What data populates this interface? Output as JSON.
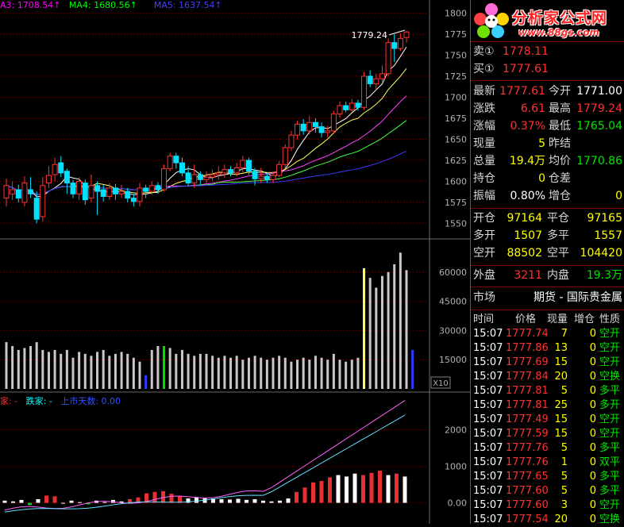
{
  "price_chart": {
    "ma_legend": [
      {
        "label": "A3: 1708.54↑",
        "color": "#ff00ff"
      },
      {
        "label": "MA4: 1680.56↑",
        "color": "#00ff00"
      },
      {
        "label": "MA5: 1637.54↑",
        "color": "#4040ff"
      }
    ],
    "high_label": "1779.24",
    "y_ticks": [
      "1800",
      "1775",
      "1750",
      "1725",
      "1700",
      "1675",
      "1650",
      "1625",
      "1600",
      "1575",
      "1550"
    ]
  },
  "volume_chart": {
    "y_ticks": [
      "60000",
      "45000",
      "30000",
      "15000"
    ],
    "multiplier": "X10"
  },
  "indicator_chart": {
    "legend": [
      {
        "label": "家: -",
        "color": "#ff3030"
      },
      {
        "label": "跌家: -",
        "color": "#00ffff"
      },
      {
        "label": "上市天数: 0.00",
        "color": "#3050ff"
      }
    ],
    "y_ticks": [
      "2000",
      "1000",
      "0.00"
    ]
  },
  "quote": {
    "logo_title": "分析家公式网",
    "logo_url": "www.88gs.com",
    "sell": {
      "label": "卖①",
      "price": "1778.11"
    },
    "buy": {
      "label": "买①",
      "price": "1777.61"
    },
    "rows": [
      {
        "l1": "最新",
        "v1": "1777.61",
        "c1": "red",
        "l2": "今开",
        "v2": "1771.00",
        "c2": "white"
      },
      {
        "l1": "涨跌",
        "v1": "6.61",
        "c1": "red",
        "l2": "最高",
        "v2": "1779.24",
        "c2": "red"
      },
      {
        "l1": "涨幅",
        "v1": "0.37%",
        "c1": "red",
        "l2": "最低",
        "v2": "1765.04",
        "c2": "green"
      },
      {
        "l1": "现量",
        "v1": "5",
        "c1": "yellow",
        "l2": "昨结",
        "v2": "",
        "c2": "white"
      },
      {
        "l1": "总量",
        "v1": "19.4万",
        "c1": "yellow",
        "l2": "均价",
        "v2": "1770.86",
        "c2": "green"
      },
      {
        "l1": "持仓",
        "v1": "0",
        "c1": "yellow",
        "l2": "仓差",
        "v2": "",
        "c2": "white"
      },
      {
        "l1": "振幅",
        "v1": "0.80%",
        "c1": "white",
        "l2": "增仓",
        "v2": "0",
        "c2": "yellow"
      }
    ],
    "rows2": [
      {
        "l1": "开仓",
        "v1": "97164",
        "c1": "yellow",
        "l2": "平仓",
        "v2": "97165",
        "c2": "yellow"
      },
      {
        "l1": "多开",
        "v1": "1507",
        "c1": "yellow",
        "l2": "多平",
        "v2": "1557",
        "c2": "yellow"
      },
      {
        "l1": "空开",
        "v1": "88502",
        "c1": "yellow",
        "l2": "空平",
        "v2": "104420",
        "c2": "yellow"
      }
    ],
    "outer": {
      "label": "外盘",
      "value": "3211"
    },
    "inner": {
      "label": "内盘",
      "value": "19.3万"
    },
    "market": {
      "label": "市场",
      "value": "期货 - 国际贵金属"
    },
    "trade_headers": [
      "时间",
      "价格",
      "现量",
      "增仓",
      "性质"
    ],
    "trades": [
      {
        "time": "15:07",
        "price": "1777.74",
        "vol": "7",
        "oi": "0",
        "type": "空开"
      },
      {
        "time": "15:07",
        "price": "1777.86",
        "vol": "13",
        "oi": "0",
        "type": "空开"
      },
      {
        "time": "15:07",
        "price": "1777.69",
        "vol": "15",
        "oi": "0",
        "type": "空开"
      },
      {
        "time": "15:07",
        "price": "1777.84",
        "vol": "20",
        "oi": "0",
        "type": "空换"
      },
      {
        "time": "15:07",
        "price": "1777.81",
        "vol": "5",
        "oi": "0",
        "type": "多平"
      },
      {
        "time": "15:07",
        "price": "1777.81",
        "vol": "25",
        "oi": "0",
        "type": "多开"
      },
      {
        "time": "15:07",
        "price": "1777.49",
        "vol": "15",
        "oi": "0",
        "type": "空开"
      },
      {
        "time": "15:07",
        "price": "1777.59",
        "vol": "15",
        "oi": "0",
        "type": "空开"
      },
      {
        "time": "15:07",
        "price": "1777.76",
        "vol": "5",
        "oi": "0",
        "type": "多平"
      },
      {
        "time": "15:07",
        "price": "1777.76",
        "vol": "1",
        "oi": "0",
        "type": "双平"
      },
      {
        "time": "15:07",
        "price": "1777.65",
        "vol": "5",
        "oi": "0",
        "type": "多平"
      },
      {
        "time": "15:07",
        "price": "1777.60",
        "vol": "5",
        "oi": "0",
        "type": "多平"
      },
      {
        "time": "15:07",
        "price": "1777.60",
        "vol": "3",
        "oi": "0",
        "type": "空开"
      },
      {
        "time": "15:07",
        "price": "1777.54",
        "vol": "20",
        "oi": "0",
        "type": "空换"
      }
    ]
  },
  "chart_data": [
    {
      "type": "candlestick",
      "ylim": [
        1540,
        1810
      ],
      "candles": [
        {
          "o": 1580,
          "c": 1595,
          "h": 1603,
          "l": 1570
        },
        {
          "o": 1585,
          "c": 1590,
          "h": 1600,
          "l": 1578
        },
        {
          "o": 1590,
          "c": 1580,
          "h": 1596,
          "l": 1575
        },
        {
          "o": 1575,
          "c": 1598,
          "h": 1606,
          "l": 1570
        },
        {
          "o": 1590,
          "c": 1585,
          "h": 1605,
          "l": 1580
        },
        {
          "o": 1580,
          "c": 1555,
          "h": 1588,
          "l": 1550
        },
        {
          "o": 1558,
          "c": 1595,
          "h": 1605,
          "l": 1552
        },
        {
          "o": 1598,
          "c": 1607,
          "h": 1618,
          "l": 1592
        },
        {
          "o": 1608,
          "c": 1620,
          "h": 1628,
          "l": 1600
        },
        {
          "o": 1622,
          "c": 1610,
          "h": 1630,
          "l": 1605
        },
        {
          "o": 1612,
          "c": 1598,
          "h": 1615,
          "l": 1585
        },
        {
          "o": 1598,
          "c": 1585,
          "h": 1602,
          "l": 1580
        },
        {
          "o": 1585,
          "c": 1600,
          "h": 1605,
          "l": 1578
        },
        {
          "o": 1598,
          "c": 1578,
          "h": 1602,
          "l": 1572
        },
        {
          "o": 1580,
          "c": 1595,
          "h": 1608,
          "l": 1575
        },
        {
          "o": 1595,
          "c": 1588,
          "h": 1600,
          "l": 1560
        },
        {
          "o": 1590,
          "c": 1582,
          "h": 1596,
          "l": 1576
        },
        {
          "o": 1582,
          "c": 1592,
          "h": 1598,
          "l": 1578
        },
        {
          "o": 1592,
          "c": 1585,
          "h": 1597,
          "l": 1578
        },
        {
          "o": 1585,
          "c": 1588,
          "h": 1596,
          "l": 1580
        },
        {
          "o": 1588,
          "c": 1580,
          "h": 1592,
          "l": 1575
        },
        {
          "o": 1580,
          "c": 1576,
          "h": 1585,
          "l": 1570
        },
        {
          "o": 1576,
          "c": 1592,
          "h": 1598,
          "l": 1570
        },
        {
          "o": 1592,
          "c": 1588,
          "h": 1596,
          "l": 1580
        },
        {
          "o": 1588,
          "c": 1595,
          "h": 1600,
          "l": 1584
        },
        {
          "o": 1595,
          "c": 1590,
          "h": 1599,
          "l": 1585
        },
        {
          "o": 1590,
          "c": 1615,
          "h": 1620,
          "l": 1588
        },
        {
          "o": 1615,
          "c": 1630,
          "h": 1634,
          "l": 1612
        },
        {
          "o": 1630,
          "c": 1622,
          "h": 1634,
          "l": 1615
        },
        {
          "o": 1622,
          "c": 1610,
          "h": 1628,
          "l": 1606
        },
        {
          "o": 1610,
          "c": 1598,
          "h": 1618,
          "l": 1594
        },
        {
          "o": 1598,
          "c": 1608,
          "h": 1620,
          "l": 1592
        },
        {
          "o": 1608,
          "c": 1602,
          "h": 1612,
          "l": 1596
        },
        {
          "o": 1602,
          "c": 1605,
          "h": 1612,
          "l": 1598
        },
        {
          "o": 1605,
          "c": 1608,
          "h": 1614,
          "l": 1600
        },
        {
          "o": 1608,
          "c": 1610,
          "h": 1618,
          "l": 1602
        },
        {
          "o": 1610,
          "c": 1614,
          "h": 1620,
          "l": 1604
        },
        {
          "o": 1614,
          "c": 1610,
          "h": 1618,
          "l": 1606
        },
        {
          "o": 1610,
          "c": 1616,
          "h": 1622,
          "l": 1606
        },
        {
          "o": 1616,
          "c": 1625,
          "h": 1630,
          "l": 1610
        },
        {
          "o": 1625,
          "c": 1612,
          "h": 1628,
          "l": 1608
        },
        {
          "o": 1612,
          "c": 1603,
          "h": 1616,
          "l": 1595
        },
        {
          "o": 1603,
          "c": 1606,
          "h": 1616,
          "l": 1598
        },
        {
          "o": 1606,
          "c": 1602,
          "h": 1610,
          "l": 1598
        },
        {
          "o": 1602,
          "c": 1607,
          "h": 1612,
          "l": 1598
        },
        {
          "o": 1607,
          "c": 1620,
          "h": 1624,
          "l": 1605
        },
        {
          "o": 1620,
          "c": 1640,
          "h": 1644,
          "l": 1615
        },
        {
          "o": 1640,
          "c": 1655,
          "h": 1660,
          "l": 1636
        },
        {
          "o": 1655,
          "c": 1668,
          "h": 1672,
          "l": 1650
        },
        {
          "o": 1668,
          "c": 1660,
          "h": 1674,
          "l": 1655
        },
        {
          "o": 1660,
          "c": 1670,
          "h": 1678,
          "l": 1656
        },
        {
          "o": 1670,
          "c": 1665,
          "h": 1675,
          "l": 1658
        },
        {
          "o": 1665,
          "c": 1658,
          "h": 1670,
          "l": 1652
        },
        {
          "o": 1658,
          "c": 1660,
          "h": 1666,
          "l": 1652
        },
        {
          "o": 1660,
          "c": 1680,
          "h": 1684,
          "l": 1656
        },
        {
          "o": 1680,
          "c": 1690,
          "h": 1695,
          "l": 1676
        },
        {
          "o": 1690,
          "c": 1685,
          "h": 1695,
          "l": 1682
        },
        {
          "o": 1685,
          "c": 1693,
          "h": 1698,
          "l": 1682
        },
        {
          "o": 1693,
          "c": 1688,
          "h": 1697,
          "l": 1684
        },
        {
          "o": 1688,
          "c": 1725,
          "h": 1730,
          "l": 1685
        },
        {
          "o": 1725,
          "c": 1716,
          "h": 1732,
          "l": 1712
        },
        {
          "o": 1716,
          "c": 1722,
          "h": 1728,
          "l": 1710
        },
        {
          "o": 1722,
          "c": 1728,
          "h": 1738,
          "l": 1718
        },
        {
          "o": 1728,
          "c": 1765,
          "h": 1770,
          "l": 1725
        },
        {
          "o": 1765,
          "c": 1758,
          "h": 1775,
          "l": 1742
        },
        {
          "o": 1758,
          "c": 1770,
          "h": 1776,
          "l": 1755
        },
        {
          "o": 1771,
          "c": 1777.61,
          "h": 1779.24,
          "l": 1765.04
        }
      ]
    },
    {
      "type": "bar",
      "ylim": [
        0,
        75000
      ],
      "values": [
        24000,
        22000,
        20000,
        21000,
        22000,
        24000,
        20000,
        19000,
        20000,
        18000,
        20000,
        16000,
        19000,
        18000,
        17000,
        19000,
        20000,
        17000,
        18000,
        19000,
        18000,
        16000,
        14000,
        7000,
        20000,
        22000,
        22000,
        21000,
        18000,
        20000,
        18000,
        17000,
        18000,
        18000,
        17000,
        16000,
        17000,
        16000,
        17000,
        15000,
        16000,
        17000,
        16000,
        15000,
        16000,
        17000,
        16000,
        14000,
        15000,
        16000,
        15000,
        17000,
        16000,
        15000,
        18000,
        15000,
        14000,
        15000,
        16000,
        62000,
        57000,
        52000,
        58000,
        60000,
        64000,
        70000,
        61000,
        20000
      ],
      "bar_colors": [
        "gray",
        "gray",
        "gray",
        "gray",
        "gray",
        "gray",
        "gray",
        "gray",
        "gray",
        "gray",
        "gray",
        "gray",
        "gray",
        "gray",
        "gray",
        "gray",
        "gray",
        "gray",
        "gray",
        "gray",
        "gray",
        "gray",
        "gray",
        "blue",
        "gray",
        "gray",
        "green",
        "gray",
        "gray",
        "gray",
        "gray",
        "gray",
        "gray",
        "gray",
        "gray",
        "gray",
        "gray",
        "gray",
        "gray",
        "gray",
        "gray",
        "gray",
        "gray",
        "gray",
        "gray",
        "gray",
        "gray",
        "gray",
        "gray",
        "gray",
        "gray",
        "gray",
        "gray",
        "gray",
        "gray",
        "gray",
        "gray",
        "gray",
        "gray",
        "yellow",
        "gray",
        "gray",
        "gray",
        "gray",
        "gray",
        "gray",
        "gray",
        "blue"
      ]
    },
    {
      "type": "bar",
      "ylim": [
        -400,
        2900
      ],
      "values": [
        60,
        40,
        80,
        -60,
        100,
        200,
        180,
        0,
        60,
        20,
        -40,
        60,
        20,
        80,
        40,
        100,
        150,
        260,
        300,
        320,
        250,
        180,
        120,
        160,
        140,
        120,
        100,
        90,
        110,
        80,
        100,
        60,
        40,
        60,
        120,
        300,
        420,
        560,
        600,
        700,
        760,
        720,
        800,
        760,
        820,
        880,
        760,
        800,
        720
      ],
      "bar_colors": [
        "white",
        "white",
        "white",
        "green",
        "white",
        "red",
        "red",
        "white",
        "white",
        "white",
        "green",
        "white",
        "white",
        "white",
        "white",
        "red",
        "red",
        "red",
        "red",
        "red",
        "red",
        "red",
        "white",
        "white",
        "white",
        "white",
        "white",
        "white",
        "white",
        "white",
        "white",
        "white",
        "white",
        "white",
        "white",
        "red",
        "red",
        "red",
        "red",
        "red",
        "white",
        "white",
        "white",
        "red",
        "red",
        "red",
        "white",
        "red",
        "white"
      ]
    }
  ]
}
